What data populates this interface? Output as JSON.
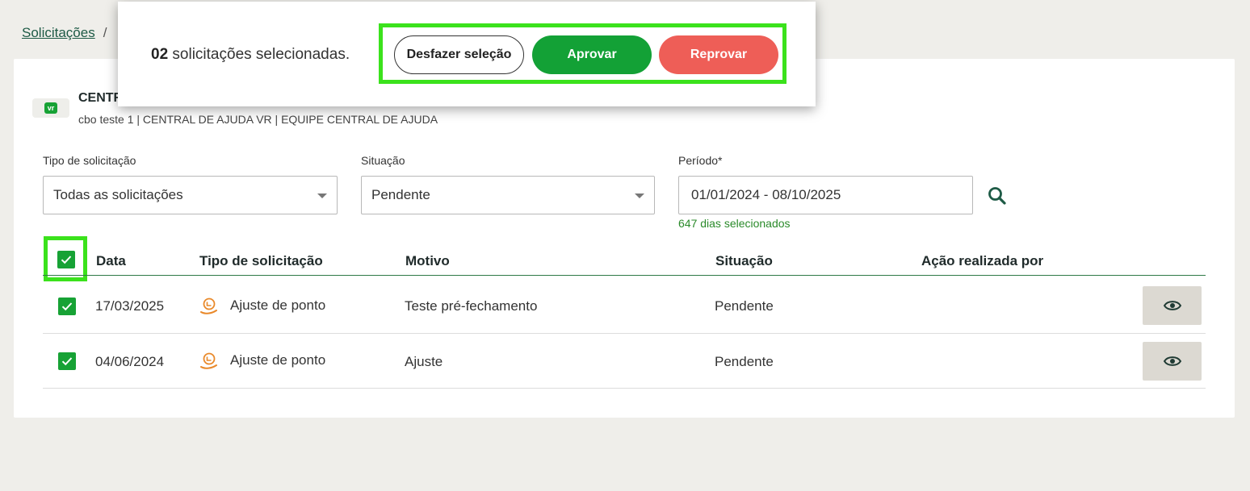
{
  "breadcrumb": {
    "root": "Solicitações",
    "separator": "/"
  },
  "company": {
    "logo_text": "vr",
    "name": "CENTR",
    "subtitle": "cbo teste 1 | CENTRAL DE AJUDA VR | EQUIPE CENTRAL DE AJUDA"
  },
  "filters": {
    "type_label": "Tipo de solicitação",
    "type_value": "Todas as solicitações",
    "status_label": "Situação",
    "status_value": "Pendente",
    "period_label": "Período*",
    "period_value": "01/01/2024 - 08/10/2025",
    "period_helper": "647 dias selecionados"
  },
  "table": {
    "headers": [
      "Data",
      "Tipo de solicitação",
      "Motivo",
      "Situação",
      "Ação realizada por"
    ],
    "rows": [
      {
        "date": "17/03/2025",
        "type": "Ajuste de ponto",
        "reason": "Teste pré-fechamento",
        "status": "Pendente",
        "action_by": ""
      },
      {
        "date": "04/06/2024",
        "type": "Ajuste de ponto",
        "reason": "Ajuste",
        "status": "Pendente",
        "action_by": ""
      }
    ]
  },
  "selection_bar": {
    "count": "02",
    "text": " solicitações selecionadas.",
    "undo_label": "Desfazer seleção",
    "approve_label": "Aprovar",
    "reject_label": "Reprovar"
  },
  "colors": {
    "brand_green": "#17a235",
    "approve": "#13a136",
    "reject": "#ee5e57",
    "highlight": "#3be21c",
    "link": "#1d5a45"
  },
  "icons": {
    "search": "search-icon",
    "view": "eye-icon",
    "request_type": "clock-hand-icon",
    "dropdown": "chevron-down-icon",
    "checkbox": "check-icon"
  }
}
